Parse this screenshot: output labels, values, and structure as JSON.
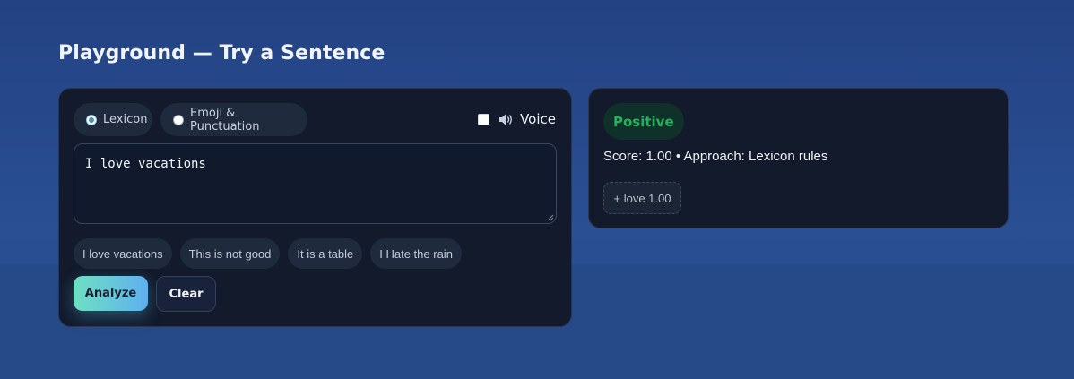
{
  "page": {
    "title": "Playground — Try a Sentence"
  },
  "input_panel": {
    "modes": [
      {
        "label": "Lexicon",
        "selected": true
      },
      {
        "label": "Emoji & Punctuation",
        "selected": false
      }
    ],
    "voice": {
      "label": "Voice",
      "checked": false,
      "icon": "speaker-icon"
    },
    "textarea_value": "I love vacations",
    "examples": [
      "I love vacations",
      "This is not good",
      "It is a table",
      "I Hate the rain"
    ],
    "analyze_label": "Analyze",
    "clear_label": "Clear"
  },
  "result_panel": {
    "sentiment": "Positive",
    "score_text": "Score: 1.00 • Approach: Lexicon rules",
    "tokens": [
      "+ love 1.00"
    ]
  },
  "colors": {
    "background": "#264a8d",
    "card": "#121a2b",
    "positive": "#22b35f",
    "accent_gradient_start": "#6ee0c2",
    "accent_gradient_end": "#5fb0ef"
  }
}
